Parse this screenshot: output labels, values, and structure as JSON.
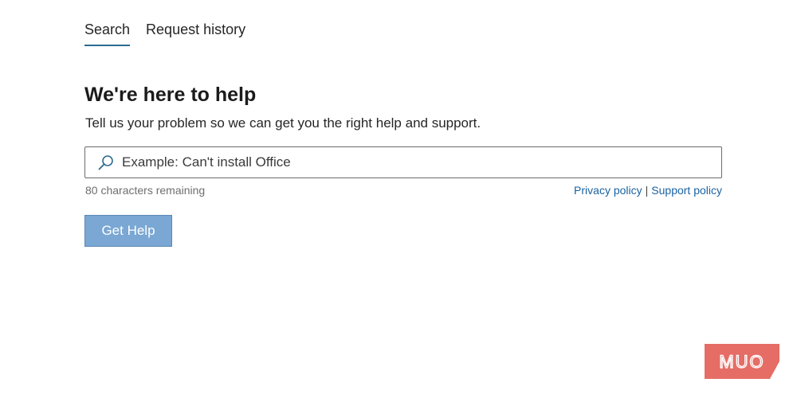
{
  "tabs": [
    {
      "label": "Search",
      "active": true
    },
    {
      "label": "Request history",
      "active": false
    }
  ],
  "main": {
    "title": "We're here to help",
    "subtitle": "Tell us your problem so we can get you the right help and support."
  },
  "search": {
    "placeholder": "Example: Can't install Office",
    "value": "",
    "icon": "search-icon",
    "chars_remaining": "80 characters remaining"
  },
  "links": {
    "privacy": "Privacy policy",
    "separator": "|",
    "support": "Support policy"
  },
  "actions": {
    "get_help_label": "Get Help"
  },
  "watermark": {
    "text": "MUO"
  },
  "colors": {
    "tab_underline": "#2b6c8f",
    "link": "#1a62a1",
    "button": "#7aa7d3",
    "watermark": "#e0544b"
  }
}
